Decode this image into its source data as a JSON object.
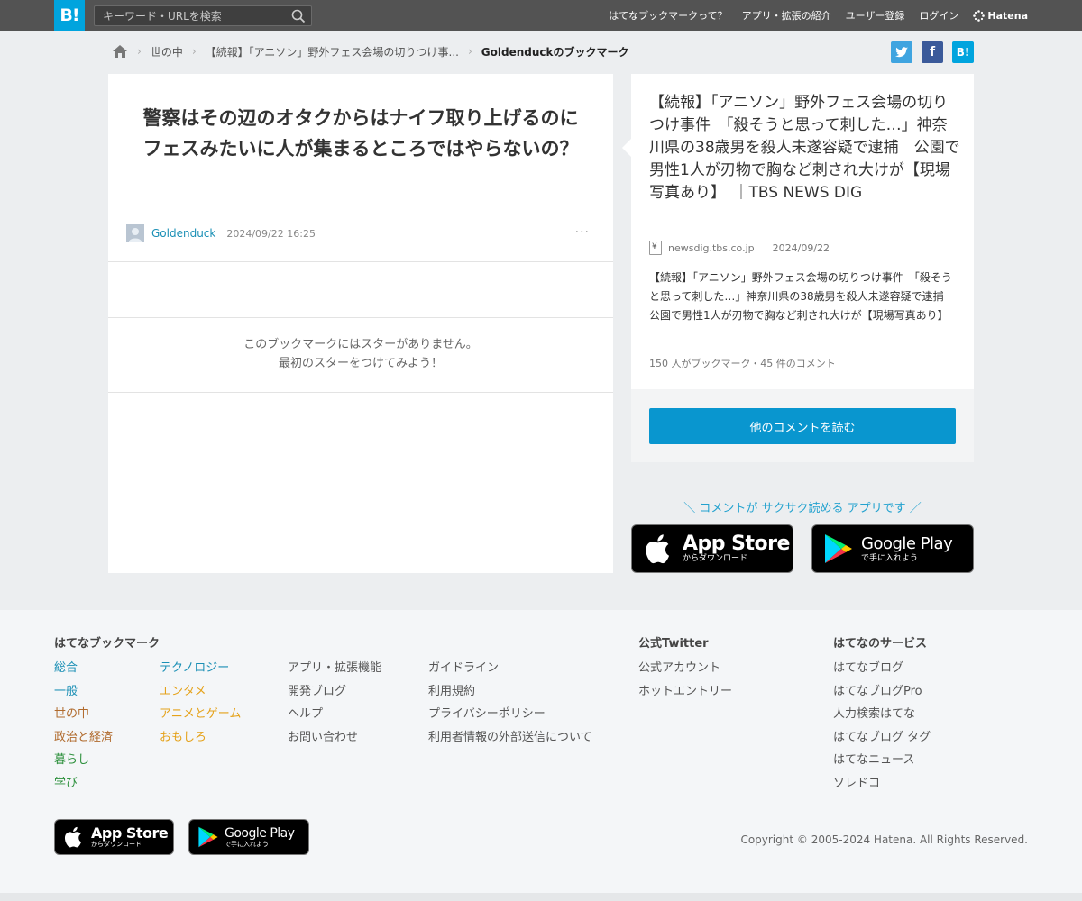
{
  "header": {
    "logo": "B!",
    "search_placeholder": "キーワード・URLを検索",
    "nav": [
      "はてなブックマークって？",
      "アプリ・拡張の紹介",
      "ユーザー登録",
      "ログイン"
    ],
    "brand": "Hatena"
  },
  "breadcrumb": {
    "items": [
      "世の中",
      "【続報】「アニソン」野外フェス会場の切りつけ事...",
      "Goldenduckのブックマーク"
    ]
  },
  "share": {
    "twitter": "t",
    "facebook": "f",
    "hatena": "B!"
  },
  "comment": {
    "text": "警察はその辺のオタクからはナイフ取り上げるのにフェスみたいに人が集まるところではやらないの？",
    "user": "Goldenduck",
    "date": "2024/09/22 16:25",
    "more": "···",
    "no_star_line1": "このブックマークにはスターがありません。",
    "no_star_line2": "最初のスターをつけてみよう！"
  },
  "entry": {
    "title": "【続報】「アニソン」野外フェス会場の切りつけ事件　「殺そうと思って刺した…」神奈川県の38歳男を殺人未遂容疑で逮捕　公園で男性1人が刃物で胸など刺され大けが【現場写真あり】　｜TBS NEWS DIG",
    "site": "newsdig.tbs.co.jp",
    "date": "2024/09/22",
    "summary": "【続報】「アニソン」野外フェス会場の切りつけ事件　「殺そうと思って刺した…」神奈川県の38歳男を殺人未遂容疑で逮捕　公園で男性1人が刃物で胸など刺され大けが【現場写真あり】",
    "counts": "150 人がブックマーク・45 件のコメント",
    "read_button": "他のコメントを読む"
  },
  "app_promo": {
    "text": "＼ コメントが サクサク読める アプリです ／",
    "appstore_big": "App Store",
    "appstore_small": "からダウンロード",
    "googleplay_big": "Google Play",
    "googleplay_small": "で手に入れよう"
  },
  "footer": {
    "heading_bookmark": "はてなブックマーク",
    "categories_a": [
      "総合",
      "一般",
      "世の中",
      "政治と経済",
      "暮らし",
      "学び"
    ],
    "categories_b": [
      "テクノロジー",
      "エンタメ",
      "アニメとゲーム",
      "おもしろ"
    ],
    "links_c": [
      "アプリ・拡張機能",
      "開発ブログ",
      "ヘルプ",
      "お問い合わせ"
    ],
    "links_d": [
      "ガイドライン",
      "利用規約",
      "プライバシーポリシー",
      "利用者情報の外部送信について"
    ],
    "heading_twitter": "公式Twitter",
    "twitter_links": [
      "公式アカウント",
      "ホットエントリー"
    ],
    "heading_services": "はてなのサービス",
    "services": [
      "はてなブログ",
      "はてなブログPro",
      "人力検索はてな",
      "はてなブログ タグ",
      "はてなニュース",
      "ソレドコ"
    ],
    "copyright": "Copyright © 2005-2024 Hatena. All Rights Reserved."
  },
  "colors": {
    "brand_blue": "#00a4de",
    "header_bg": "#535353",
    "button_blue": "#0996cf",
    "cat_general": "#1a8fb5",
    "cat_world": "#b06a2c",
    "cat_ent": "#e5a21a",
    "cat_life": "#2a8f3a"
  }
}
